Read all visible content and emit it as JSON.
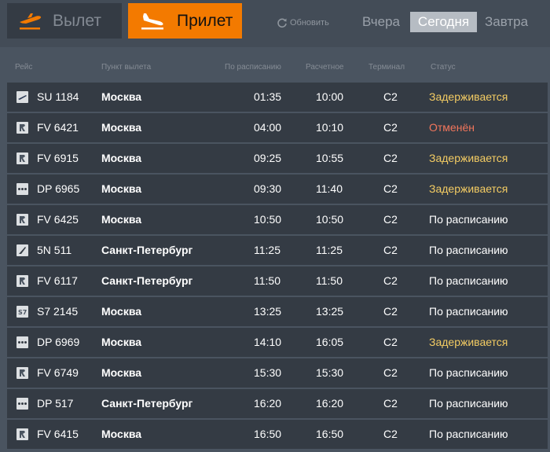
{
  "top": {
    "departure_label": "Вылет",
    "arrival_label": "Прилет",
    "refresh_label": "Обновить",
    "days": {
      "yesterday": "Вчера",
      "today": "Сегодня",
      "tomorrow": "Завтра"
    }
  },
  "columns": {
    "flight": "Рейс",
    "origin": "Пункт вылета",
    "scheduled": "По расписанию",
    "estimated": "Расчетное",
    "terminal": "Терминал",
    "status": "Статус"
  },
  "colors": {
    "accent": "#f37a00",
    "delayed": "#f4cc63",
    "cancelled": "#f2765c",
    "row_bg": "#343b44",
    "page_bg": "#4a5460"
  },
  "flights": [
    {
      "airline_icon": "aeroflot-logo-icon",
      "flight": "SU 1184",
      "city": "Москва",
      "scheduled": "01:35",
      "estimated": "10:00",
      "terminal": "C2",
      "status": "Задерживается",
      "status_type": "delayed"
    },
    {
      "airline_icon": "rossiya-logo-icon",
      "flight": "FV 6421",
      "city": "Москва",
      "scheduled": "04:00",
      "estimated": "10:10",
      "terminal": "C2",
      "status": "Отменён",
      "status_type": "cancelled"
    },
    {
      "airline_icon": "rossiya-logo-icon",
      "flight": "FV 6915",
      "city": "Москва",
      "scheduled": "09:25",
      "estimated": "10:55",
      "terminal": "C2",
      "status": "Задерживается",
      "status_type": "delayed"
    },
    {
      "airline_icon": "pobeda-logo-icon",
      "flight": "DP 6965",
      "city": "Москва",
      "scheduled": "09:30",
      "estimated": "11:40",
      "terminal": "C2",
      "status": "Задерживается",
      "status_type": "delayed"
    },
    {
      "airline_icon": "rossiya-logo-icon",
      "flight": "FV 6425",
      "city": "Москва",
      "scheduled": "10:50",
      "estimated": "10:50",
      "terminal": "C2",
      "status": "По расписанию",
      "status_type": "ontime"
    },
    {
      "airline_icon": "nordwind-logo-icon",
      "flight": "5N 511",
      "city": "Санкт-Петербург",
      "scheduled": "11:25",
      "estimated": "11:25",
      "terminal": "C2",
      "status": "По расписанию",
      "status_type": "ontime"
    },
    {
      "airline_icon": "rossiya-logo-icon",
      "flight": "FV 6117",
      "city": "Санкт-Петербург",
      "scheduled": "11:50",
      "estimated": "11:50",
      "terminal": "C2",
      "status": "По расписанию",
      "status_type": "ontime"
    },
    {
      "airline_icon": "s7-logo-icon",
      "flight": "S7 2145",
      "city": "Москва",
      "scheduled": "13:25",
      "estimated": "13:25",
      "terminal": "C2",
      "status": "По расписанию",
      "status_type": "ontime"
    },
    {
      "airline_icon": "pobeda-logo-icon",
      "flight": "DP 6969",
      "city": "Москва",
      "scheduled": "14:10",
      "estimated": "16:05",
      "terminal": "C2",
      "status": "Задерживается",
      "status_type": "delayed"
    },
    {
      "airline_icon": "rossiya-logo-icon",
      "flight": "FV 6749",
      "city": "Москва",
      "scheduled": "15:30",
      "estimated": "15:30",
      "terminal": "C2",
      "status": "По расписанию",
      "status_type": "ontime"
    },
    {
      "airline_icon": "pobeda-logo-icon",
      "flight": "DP 517",
      "city": "Санкт-Петербург",
      "scheduled": "16:20",
      "estimated": "16:20",
      "terminal": "C2",
      "status": "По расписанию",
      "status_type": "ontime"
    },
    {
      "airline_icon": "rossiya-logo-icon",
      "flight": "FV 6415",
      "city": "Москва",
      "scheduled": "16:50",
      "estimated": "16:50",
      "terminal": "C2",
      "status": "По расписанию",
      "status_type": "ontime"
    }
  ]
}
